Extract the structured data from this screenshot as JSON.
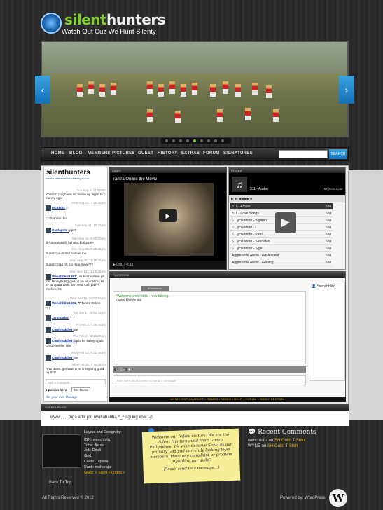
{
  "header": {
    "logo_a": "silent",
    "logo_b": "hunters",
    "tagline": "Watch Out Cuz We Hunt Silenty"
  },
  "slider": {
    "prev": "‹",
    "next": "›"
  },
  "nav": {
    "items": [
      "HOME",
      "BLOG",
      "MEMBERS",
      "PICTURES",
      "GUEST",
      "HISTORY",
      "EXTRAS",
      "FORUM",
      "SIGNATURES"
    ],
    "search_button": "SEARCH"
  },
  "chatbox": {
    "title": "silenthunters",
    "url": "sirven-silenthunters.chatango.com",
    "messages": [
      {
        "ts": "Tue Aug 6, 11:05PM",
        "name": "",
        "text": "Xebec8: maghasik na namin ng lagim to c manoy egat"
      },
      {
        "ts": "Mon Aug 22, 7:15:48pm",
        "name": "McSkott:",
        "text": "□"
      },
      {
        "ts": "",
        "name": "",
        "text": "Co0Lsprite: hoi"
      },
      {
        "ts": "Sun Sep 11, 10:16pm",
        "name": "Co0lsprite:",
        "text": "ppz2"
      },
      {
        "ts": "Sun Sep 16, 8:48:00pm",
        "name": "",
        "text": "lllPurementallll: hahaha buti pa ri?"
      },
      {
        "ts": "Mon Sep 26, 7:26:38pm",
        "name": "",
        "text": "Super2: ol-motah naman mo"
      },
      {
        "ts": "Mon Sep 26, 11:48:25pm",
        "name": "",
        "text": "Super2: nag ph mo mga mew???"
      },
      {
        "ts": "Mon Nov 14, 11:06:35pm",
        "name": "Wenchblitz1982:",
        "text": "ulu tantraonline ph me. Hinay2x lng gud up pa lvl until ma lvl. 87 tah para vedi.. no need rush pa lvl. ehehehehe"
      },
      {
        "ts": "Wed Jan 11, 10:07:56pm",
        "name": "Wenchblitz1982:",
        "text": "❤ Tantra Online PH"
      },
      {
        "ts": "Tue Jan 17, 8:54:42pm",
        "name": "Jammarku:",
        "text": "^_^"
      },
      {
        "ts": "Fri Feb 3, 7:48:46pm",
        "name": "Cordovakiller:",
        "text": "aw"
      },
      {
        "ts": "Thu Feb 9, 11:21:09pm",
        "name": "Cordovakiller:",
        "text": "apila ko sa inyo guild CordovaKiller ako"
      },
      {
        "ts": "Mon Feb 13, 6:12:45pm",
        "name": "Cordovakiller:",
        "text": "aw"
      },
      {
        "ts": "Sun Feb 19, 7:34:28pm",
        "name": "",
        "text": "Anon3566: gumawa n po b kayo ng guild ng SH?"
      }
    ],
    "input_placeholder": "Add a comment...",
    "people": "1 person here",
    "setname": "Set Name",
    "getown": "Get your own",
    "manage": "Manage"
  },
  "video": {
    "header": "VIDEO",
    "title": "Tantra Online the Movie",
    "time": "0:00 / 4:33"
  },
  "player": {
    "header": "PLAYER",
    "now": "311 - Amber",
    "tracks": [
      "311 - Amber",
      "311 - Love Songs",
      "6 Cycle Mind - Biglaan",
      "6 Cycle Mind - I",
      "6 Cycle Mind - Paba",
      "6 Cycle Mind - Sandalan",
      "6 Cycle Mind - Sige",
      "Aggressive Audio - Adolescent",
      "Aggressive Audio - Feeling"
    ],
    "add": "Add",
    "brand": "MIXPOD.COM"
  },
  "chatroom": {
    "header": "CHATROOM",
    "tab": "#Chatroom",
    "welcome": "*Welcome wenchblitz, now talking.",
    "line": "<wenchblitz> aw",
    "user": "*wenchblitz",
    "status": "Online",
    "placeholder": "Type here and hit enter to send a message."
  },
  "chatroom_nav": "ANIME OST • MARKET • GAMES • VIDEO • HELP • FORUM • SIGGY SECTION",
  "guest": {
    "header": "GUEST UPDATE",
    "text": "www.,.,.,, mga adik jud nyahahahha ^_^ agi lng kow :-p"
  },
  "footer": {
    "designer_title": "Layout and Design by:",
    "ign": "IGN: wenchblitz",
    "tribe": "Tribe: Asura",
    "job": "Job: Dindi",
    "god": "God:",
    "caste": "Caste: Tapasa",
    "rank": "Rank: maharaja",
    "guild": "Guild: » Silent Hunters »",
    "note": "Welcome our fellow visitors. We are the Silent Hunters guild from Tantra Philippines. We wish to serve Shiva as our primary God and currently looking loyal members. Have any complaint or problem regarding our guild?",
    "note_end": "Please send us a message. :)",
    "recent_title": "Recent Comments",
    "recent": [
      {
        "who": "wenchblitz",
        "on": "SH Guild T-Shirt"
      },
      {
        "who": "WYNE",
        "on": "SH Guild T-Shirt"
      }
    ],
    "back_to_top": "Back To Top",
    "copyright": "All Rights Reserved ® 2012",
    "powered": "Powered by: WordPress"
  }
}
